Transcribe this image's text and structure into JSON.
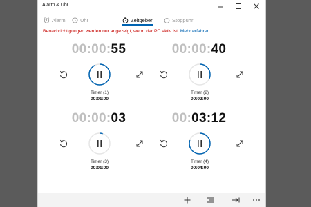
{
  "window": {
    "title": "Alarm & Uhr"
  },
  "tabs": [
    {
      "label": "Alarm",
      "icon": "alarm-icon",
      "active": false
    },
    {
      "label": "Uhr",
      "icon": "clock-icon",
      "active": false
    },
    {
      "label": "Zeitgeber",
      "icon": "timer-icon",
      "active": true
    },
    {
      "label": "Stoppuhr",
      "icon": "stopwatch-icon",
      "active": false
    }
  ],
  "notice": {
    "text": "Benachrichtigungen werden nur angezeigt, wenn der PC aktiv ist.",
    "link": "Mehr erfahren"
  },
  "timers": [
    {
      "time_dim": "00:00:",
      "time_bright": "55",
      "name": "Timer (1)",
      "duration": "00:01:00",
      "progress": 0.92
    },
    {
      "time_dim": "00:00:",
      "time_bright": "40",
      "name": "Timer (2)",
      "duration": "00:02:00",
      "progress": 0.33
    },
    {
      "time_dim": "00:00:",
      "time_bright": "03",
      "name": "Timer (3)",
      "duration": "00:01:00",
      "progress": 0.05
    },
    {
      "time_dim": "00:",
      "time_bright": "03:12",
      "name": "Timer (4)",
      "duration": "00:04:00",
      "progress": 0.8
    }
  ],
  "colors": {
    "accent": "#0063b1",
    "notice": "#c50500",
    "dim_digits": "#bfbfbf"
  }
}
